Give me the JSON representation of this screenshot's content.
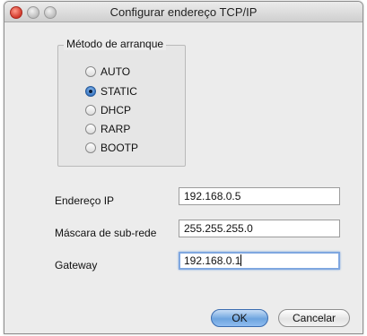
{
  "window": {
    "title": "Configurar endereço TCP/IP"
  },
  "boot_method": {
    "legend": "Método de arranque",
    "options": [
      "AUTO",
      "STATIC",
      "DHCP",
      "RARP",
      "BOOTP"
    ],
    "selected": "STATIC"
  },
  "fields": {
    "ip": {
      "label": "Endereço IP",
      "value": "192.168.0.5"
    },
    "subnet": {
      "label": "Máscara de sub-rede",
      "value": "255.255.255.0"
    },
    "gateway": {
      "label": "Gateway",
      "value": "192.168.0.1"
    }
  },
  "buttons": {
    "ok": "OK",
    "cancel": "Cancelar"
  },
  "colors": {
    "ok_button_blue": "#6ea4df",
    "focus_ring": "#7fa7e0"
  }
}
